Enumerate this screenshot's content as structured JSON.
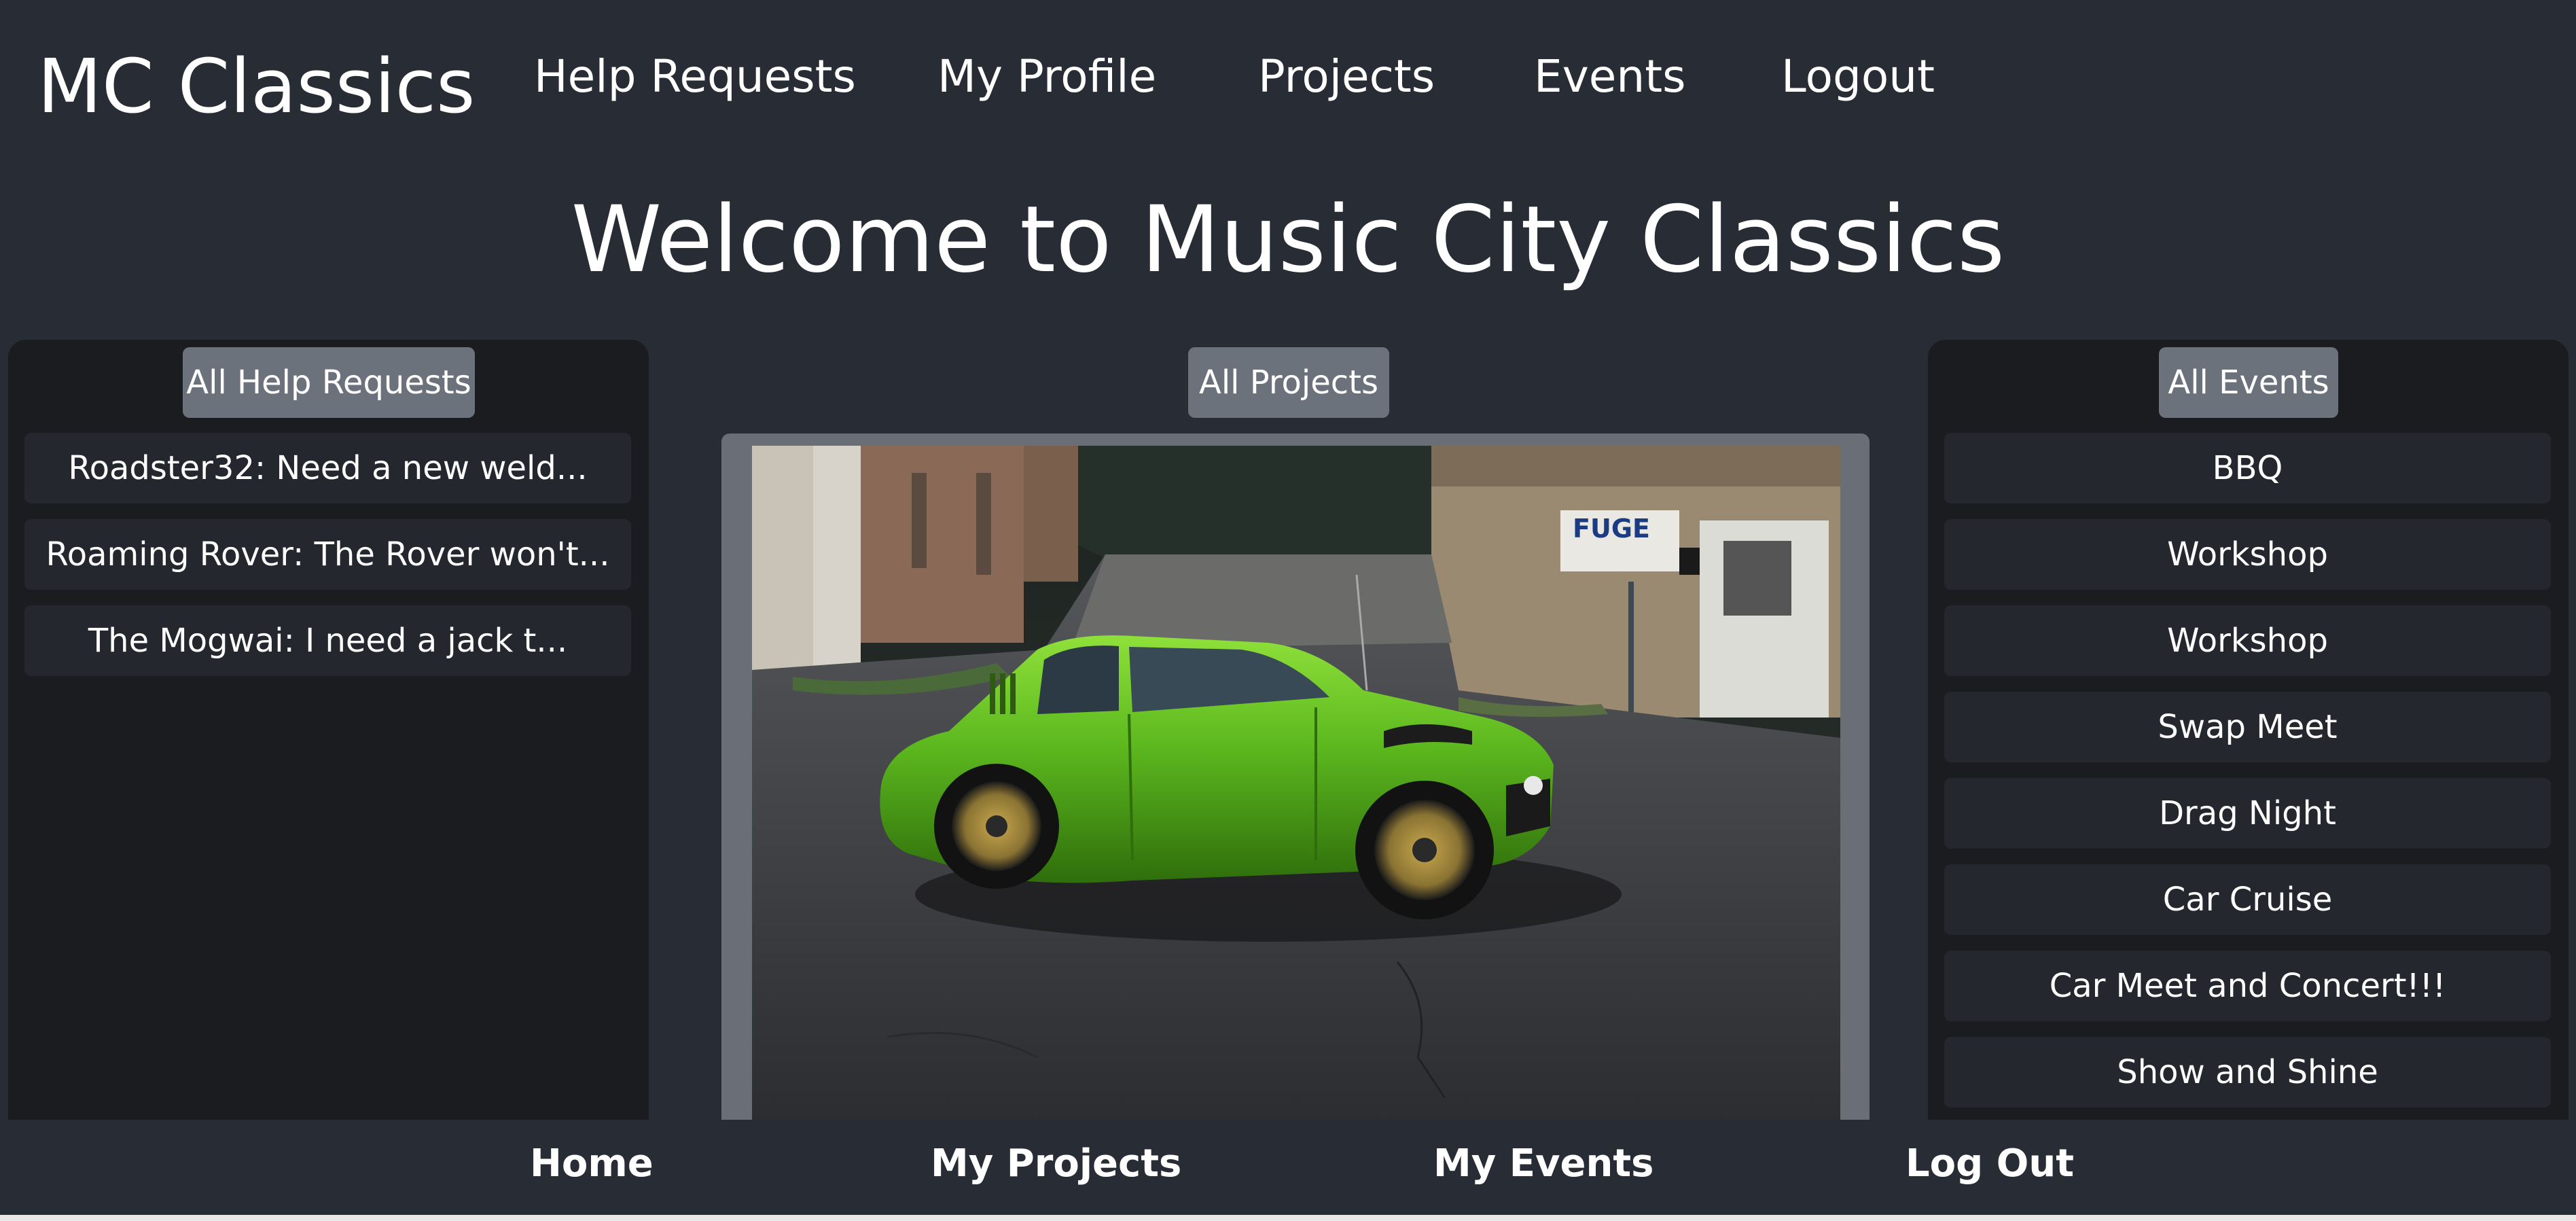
{
  "header": {
    "brand": "MC Classics",
    "nav": [
      "Help Requests",
      "My Profile",
      "Projects",
      "Events",
      "Logout"
    ]
  },
  "welcome_title": "Welcome to Music City Classics",
  "help_requests": {
    "button_label": "All Help Requests",
    "items": [
      "Roadster32: Need a new weld...",
      "Roaming Rover: The Rover won't...",
      "The Mogwai: I need a jack t..."
    ]
  },
  "projects": {
    "button_label": "All Projects",
    "image_icon": "green-classic-car-photo"
  },
  "events": {
    "button_label": "All Events",
    "items": [
      "BBQ",
      "Workshop",
      "Workshop",
      "Swap Meet",
      "Drag Night",
      "Car Cruise",
      "Car Meet and Concert!!!",
      "Show and Shine"
    ]
  },
  "footer": {
    "nav": [
      "Home",
      "My Projects",
      "My Events",
      "Log Out"
    ]
  },
  "colors": {
    "background": "#282c34",
    "panel": "#1b1c20",
    "list_item": "#24272d",
    "button": "#6c727c",
    "car_green": "#5cb81e"
  }
}
